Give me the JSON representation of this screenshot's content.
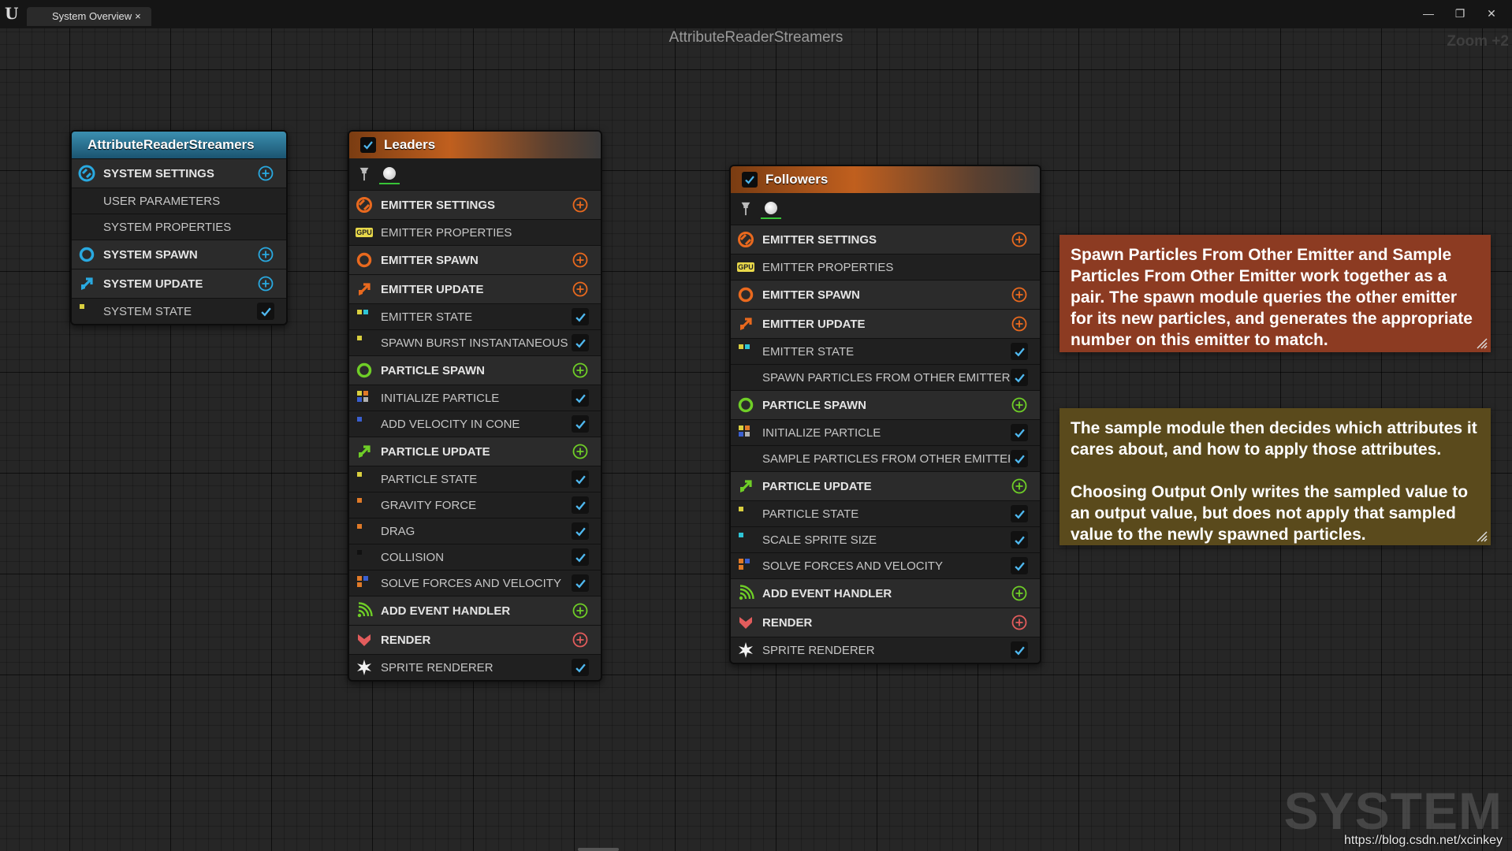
{
  "window": {
    "tab_label": "System Overview",
    "tab_close": "×",
    "minimize": "—",
    "restore": "❐",
    "close": "✕",
    "logo_glyph": "U"
  },
  "graph": {
    "title": "AttributeReaderStreamers",
    "zoom": "Zoom +2",
    "watermark": "SYSTEM",
    "url": "https://blog.csdn.net/xcinkey"
  },
  "system_node": {
    "title": "AttributeReaderStreamers",
    "rows": [
      {
        "label": "SYSTEM SETTINGS",
        "kind": "group",
        "icon": "system-settings-icon",
        "color": "#29a9e0"
      },
      {
        "label": "USER PARAMETERS",
        "kind": "module"
      },
      {
        "label": "SYSTEM PROPERTIES",
        "kind": "module"
      },
      {
        "label": "SYSTEM SPAWN",
        "kind": "group",
        "icon": "spawn-icon",
        "color": "#29a9e0"
      },
      {
        "label": "SYSTEM UPDATE",
        "kind": "group",
        "icon": "update-icon",
        "color": "#29a9e0"
      },
      {
        "label": "SYSTEM STATE",
        "kind": "module",
        "enabled": true
      }
    ]
  },
  "leaders_node": {
    "title": "Leaders",
    "enabled": true,
    "rows": [
      {
        "label": "EMITTER SETTINGS",
        "kind": "group",
        "icon": "emitter-settings-icon",
        "color": "#e9691e"
      },
      {
        "label": "EMITTER PROPERTIES",
        "kind": "module",
        "icon": "gpu-icon"
      },
      {
        "label": "EMITTER SPAWN",
        "kind": "group",
        "icon": "spawn-icon",
        "color": "#e9691e"
      },
      {
        "label": "EMITTER UPDATE",
        "kind": "group",
        "icon": "update-icon",
        "color": "#e9691e"
      },
      {
        "label": "EMITTER STATE",
        "kind": "module",
        "enabled": true
      },
      {
        "label": "SPAWN BURST INSTANTANEOUS",
        "kind": "module",
        "enabled": true
      },
      {
        "label": "PARTICLE SPAWN",
        "kind": "group",
        "icon": "spawn-icon",
        "color": "#6fce27"
      },
      {
        "label": "INITIALIZE PARTICLE",
        "kind": "module",
        "enabled": true
      },
      {
        "label": "ADD VELOCITY IN CONE",
        "kind": "module",
        "enabled": true
      },
      {
        "label": "PARTICLE UPDATE",
        "kind": "group",
        "icon": "update-icon",
        "color": "#6fce27"
      },
      {
        "label": "PARTICLE STATE",
        "kind": "module",
        "enabled": true
      },
      {
        "label": "GRAVITY FORCE",
        "kind": "module",
        "enabled": true
      },
      {
        "label": "DRAG",
        "kind": "module",
        "enabled": true
      },
      {
        "label": "COLLISION",
        "kind": "module",
        "enabled": true
      },
      {
        "label": "SOLVE FORCES AND VELOCITY",
        "kind": "module",
        "enabled": true
      },
      {
        "label": "ADD EVENT HANDLER",
        "kind": "group",
        "icon": "event-icon",
        "color": "#6fce27"
      },
      {
        "label": "RENDER",
        "kind": "group",
        "icon": "render-icon",
        "color": "#e25c5c"
      },
      {
        "label": "SPRITE RENDERER",
        "kind": "module",
        "icon": "sprite-icon",
        "enabled": true
      }
    ]
  },
  "followers_node": {
    "title": "Followers",
    "enabled": true,
    "rows": [
      {
        "label": "EMITTER SETTINGS",
        "kind": "group",
        "icon": "emitter-settings-icon",
        "color": "#e9691e"
      },
      {
        "label": "EMITTER PROPERTIES",
        "kind": "module",
        "icon": "gpu-icon"
      },
      {
        "label": "EMITTER SPAWN",
        "kind": "group",
        "icon": "spawn-icon",
        "color": "#e9691e"
      },
      {
        "label": "EMITTER UPDATE",
        "kind": "group",
        "icon": "update-icon",
        "color": "#e9691e"
      },
      {
        "label": "EMITTER STATE",
        "kind": "module",
        "enabled": true
      },
      {
        "label": "SPAWN PARTICLES FROM OTHER EMITTER",
        "kind": "module",
        "enabled": true
      },
      {
        "label": "PARTICLE SPAWN",
        "kind": "group",
        "icon": "spawn-icon",
        "color": "#6fce27"
      },
      {
        "label": "INITIALIZE PARTICLE",
        "kind": "module",
        "enabled": true
      },
      {
        "label": "SAMPLE PARTICLES FROM OTHER EMITTER",
        "kind": "module",
        "enabled": true
      },
      {
        "label": "PARTICLE UPDATE",
        "kind": "group",
        "icon": "update-icon",
        "color": "#6fce27"
      },
      {
        "label": "PARTICLE STATE",
        "kind": "module",
        "enabled": true
      },
      {
        "label": "SCALE SPRITE SIZE",
        "kind": "module",
        "enabled": true
      },
      {
        "label": "SOLVE FORCES AND VELOCITY",
        "kind": "module",
        "enabled": true
      },
      {
        "label": "ADD EVENT HANDLER",
        "kind": "group",
        "icon": "event-icon",
        "color": "#6fce27"
      },
      {
        "label": "RENDER",
        "kind": "group",
        "icon": "render-icon",
        "color": "#e25c5c"
      },
      {
        "label": "SPRITE RENDERER",
        "kind": "module",
        "icon": "sprite-icon",
        "enabled": true
      }
    ]
  },
  "comments": {
    "spawn_comment": {
      "color": "#8c3b22",
      "text": "Spawn Particles From Other Emitter and Sample Particles From Other Emitter work together as a pair. The spawn module queries the other emitter for its new particles, and generates the appropriate number on this emitter to match."
    },
    "sample_comment": {
      "color": "#5a4a1c",
      "text_1": "The sample module then decides which attributes it cares about, and how to apply those attributes.",
      "text_2": "Choosing Output Only writes the sampled value to an output value, but does not apply that sampled value to the newly spawned particles."
    }
  }
}
